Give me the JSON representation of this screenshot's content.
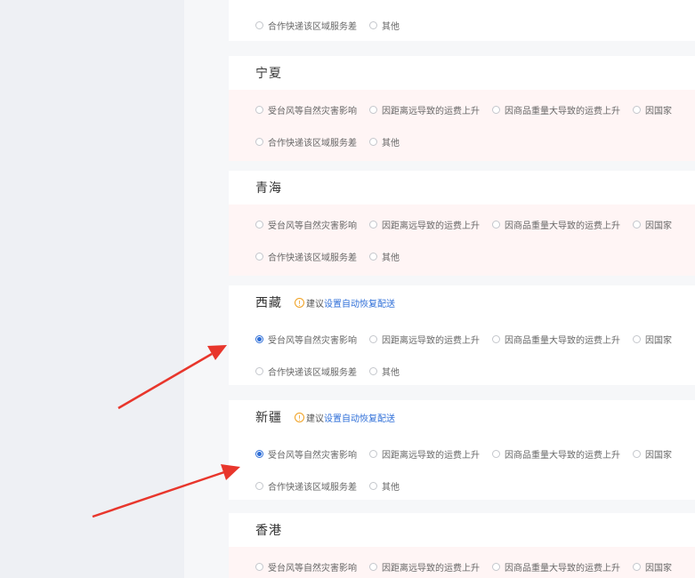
{
  "options_full": [
    "受台风等自然灾害影响",
    "因距离远导致的运费上升",
    "因商品重量大导致的运费上升",
    "因国家"
  ],
  "options_second": [
    "合作快递该区域服务差",
    "其他"
  ],
  "tip": {
    "prefix": "建议",
    "link": "设置自动恢复配送"
  },
  "regions": [
    {
      "name": "宁夏",
      "selected": null,
      "tip": false
    },
    {
      "name": "青海",
      "selected": null,
      "tip": false
    },
    {
      "name": "西藏",
      "selected": 0,
      "tip": true
    },
    {
      "name": "新疆",
      "selected": 0,
      "tip": true
    },
    {
      "name": "香港",
      "selected": null,
      "tip": false
    }
  ],
  "colors": {
    "accent": "#2f6fd8",
    "arrow": "#e8362c",
    "tip": "#f0a020",
    "pink_bg": "#fff5f5"
  }
}
